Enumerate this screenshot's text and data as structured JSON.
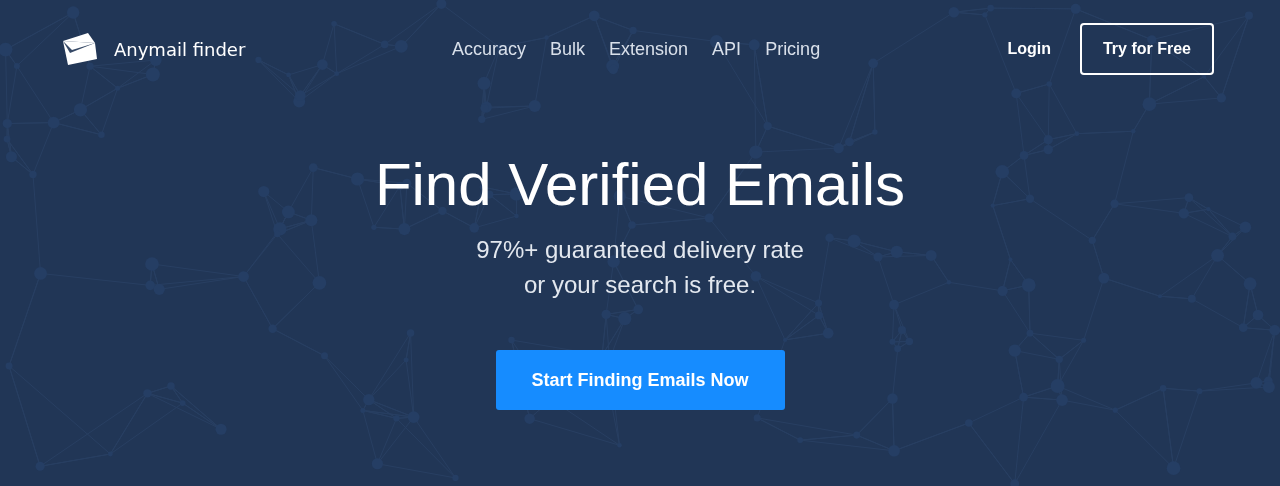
{
  "brand": {
    "name": "Anymail finder"
  },
  "nav": [
    {
      "label": "Accuracy"
    },
    {
      "label": "Bulk"
    },
    {
      "label": "Extension"
    },
    {
      "label": "API"
    },
    {
      "label": "Pricing"
    }
  ],
  "actions": {
    "login": "Login",
    "trial": "Try for Free"
  },
  "hero": {
    "title": "Find Verified Emails",
    "subtitle_lines": [
      "97%+ guaranteed delivery rate",
      "or your search is free."
    ],
    "cta": "Start Finding Emails Now"
  }
}
